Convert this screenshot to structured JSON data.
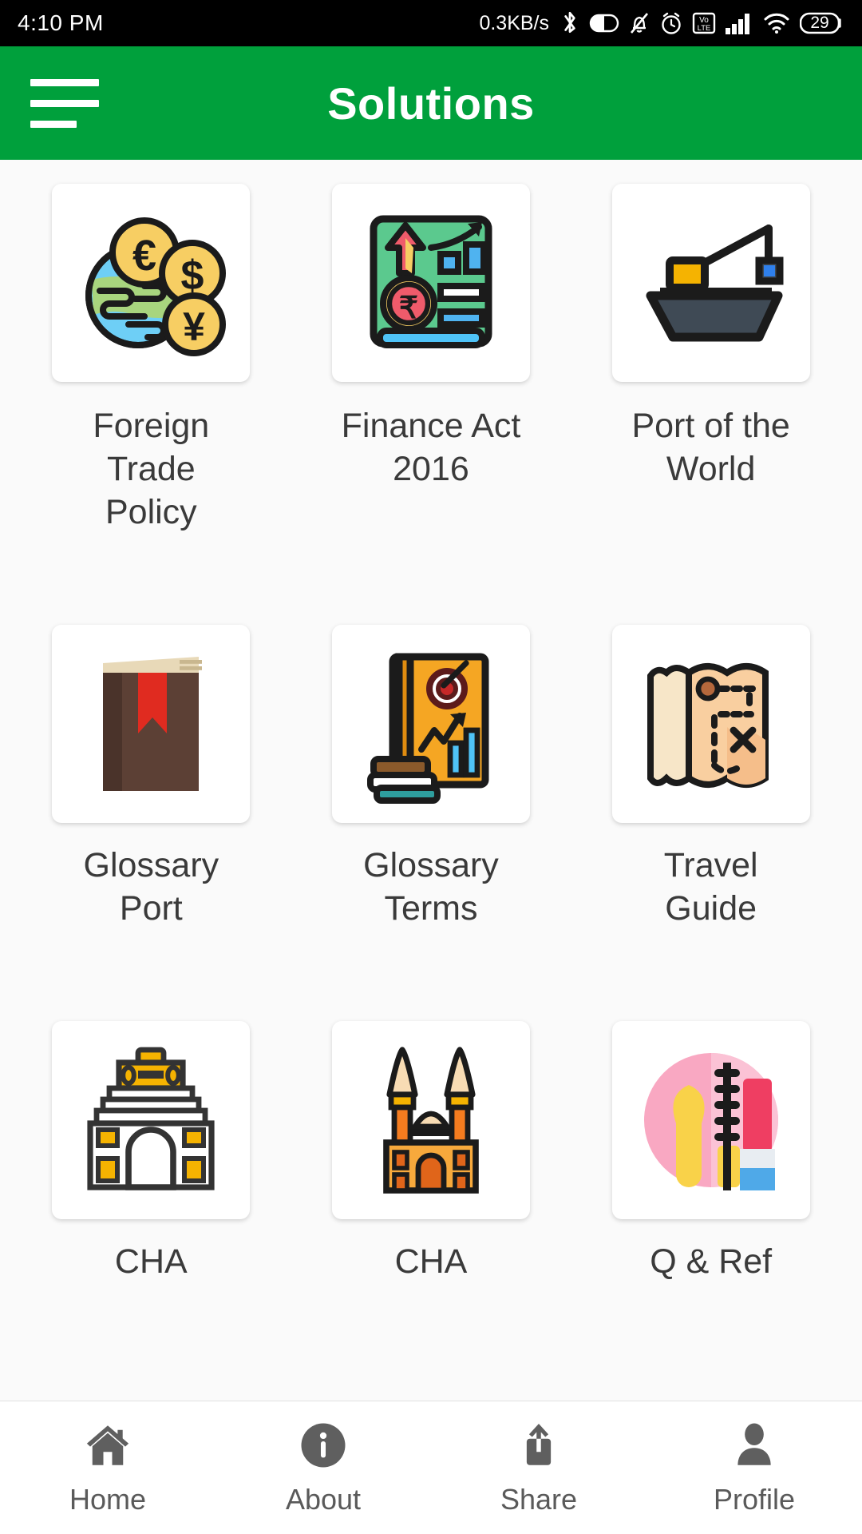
{
  "status_bar": {
    "time": "4:10 PM",
    "network_speed": "0.3KB/s",
    "volte_label_top": "Vo",
    "volte_label_bottom": "LTE",
    "battery_percent": "29",
    "icons": [
      "bluetooth-icon",
      "dnd-icon",
      "mute-bell-icon",
      "alarm-icon",
      "volte-icon",
      "signal-icon",
      "wifi-icon",
      "battery-icon"
    ]
  },
  "app_bar": {
    "title": "Solutions",
    "menu_icon": "hamburger-menu-icon",
    "background_color": "#00A03C",
    "title_color": "#FFFFFF"
  },
  "grid": {
    "items": [
      {
        "label": "Foreign\nTrade\nPolicy",
        "line1": "Foreign",
        "line2": "Trade",
        "line3": "Policy",
        "icon": "globe-currency-coins-icon"
      },
      {
        "label": "Finance Act\n2016",
        "line1": "Finance Act",
        "line2": "2016",
        "line3": "",
        "icon": "finance-book-chart-icon"
      },
      {
        "label": "Port of the\nWorld",
        "line1": "Port of the",
        "line2": "World",
        "line3": "",
        "icon": "cargo-ship-crane-icon"
      },
      {
        "label": "Glossary\nPort",
        "line1": "Glossary",
        "line2": "Port",
        "line3": "",
        "icon": "brown-book-bookmark-icon"
      },
      {
        "label": "Glossary\nTerms",
        "line1": "Glossary",
        "line2": "Terms",
        "line3": "",
        "icon": "orange-book-target-icon"
      },
      {
        "label": "Travel\nGuide",
        "line1": "Travel",
        "line2": "Guide",
        "line3": "",
        "icon": "treasure-map-icon"
      },
      {
        "label": "CHA",
        "line1": "CHA",
        "line2": "",
        "line3": "",
        "icon": "india-gate-monument-icon"
      },
      {
        "label": "CHA",
        "line1": "CHA",
        "line2": "",
        "line3": "",
        "icon": "gateway-of-india-icon"
      },
      {
        "label": "Q & Ref",
        "line1": "Q & Ref",
        "line2": "",
        "line3": "",
        "icon": "makeup-cosmetics-circle-icon"
      }
    ]
  },
  "bottom_nav": {
    "items": [
      {
        "label": "Home",
        "icon": "home-icon"
      },
      {
        "label": "About",
        "icon": "info-circle-icon"
      },
      {
        "label": "Share",
        "icon": "share-upload-icon"
      },
      {
        "label": "Profile",
        "icon": "person-icon"
      }
    ],
    "icon_color": "#5F5F5F"
  }
}
